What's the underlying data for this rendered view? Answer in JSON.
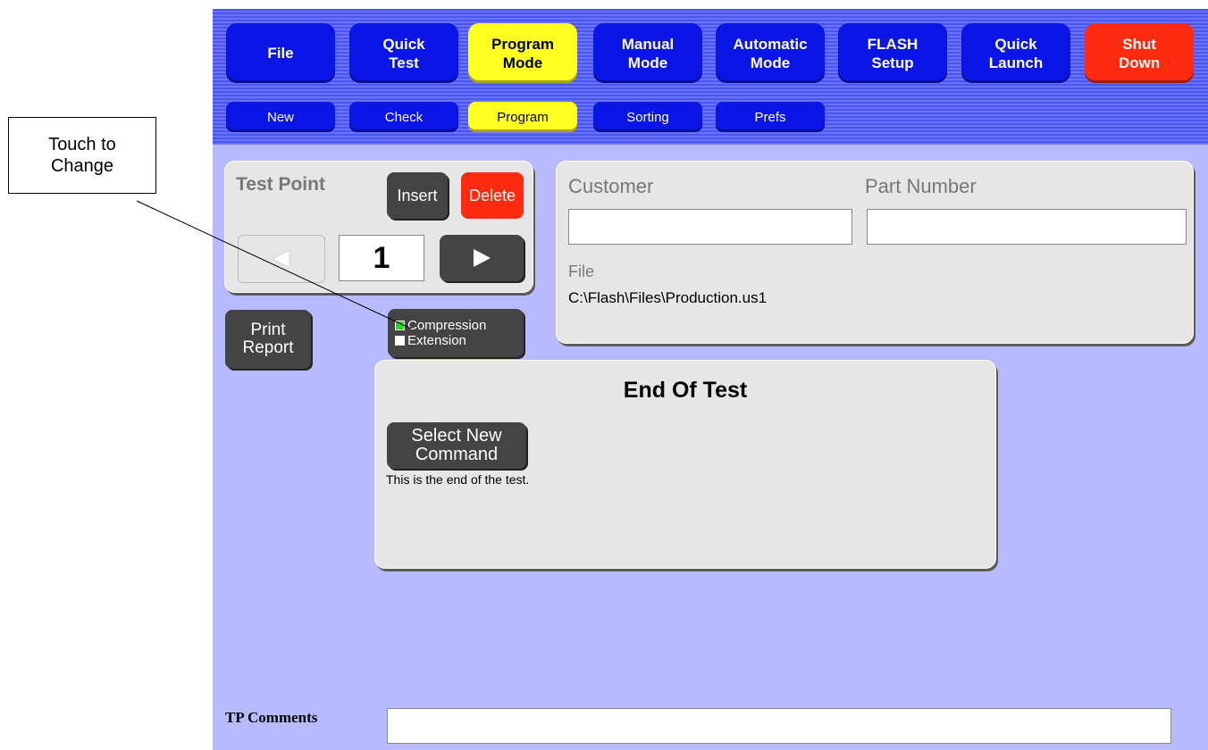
{
  "callout": {
    "text_line1": "Touch to",
    "text_line2": "Change"
  },
  "top_nav": [
    {
      "label": "File",
      "state": "normal"
    },
    {
      "label": "Quick\nTest",
      "state": "normal"
    },
    {
      "label": "Program\nMode",
      "state": "active"
    },
    {
      "label": "Manual\nMode",
      "state": "normal"
    },
    {
      "label": "Automatic\nMode",
      "state": "normal"
    },
    {
      "label": "FLASH\nSetup",
      "state": "normal"
    },
    {
      "label": "Quick\nLaunch",
      "state": "normal"
    },
    {
      "label": "Shut\nDown",
      "state": "danger"
    }
  ],
  "sub_nav": [
    {
      "label": "New",
      "state": "normal"
    },
    {
      "label": "Check",
      "state": "normal"
    },
    {
      "label": "Program",
      "state": "active"
    },
    {
      "label": "Sorting",
      "state": "normal"
    },
    {
      "label": "Prefs",
      "state": "normal"
    }
  ],
  "test_point": {
    "title": "Test Point",
    "insert_label": "Insert",
    "delete_label": "Delete",
    "number": "1",
    "prev_icon": "left-arrow-icon",
    "next_icon": "right-arrow-icon"
  },
  "mode_toggle": {
    "compression_label": "Compression",
    "extension_label": "Extension",
    "selected": "Compression"
  },
  "print_report_label": "Print\nReport",
  "info": {
    "customer_label": "Customer",
    "customer_value": "",
    "part_number_label": "Part Number",
    "part_number_value": "",
    "file_label": "File",
    "file_path": "C:\\Flash\\Files\\Production.us1"
  },
  "command": {
    "title": "End Of Test",
    "select_label": "Select New\nCommand",
    "description": "This is the end of the test."
  },
  "tp_comments": {
    "label": "TP Comments",
    "value": ""
  },
  "colors": {
    "background": "#b7baff",
    "nav_blue": "#0a16e6",
    "active_yellow": "#ffff22",
    "danger_red": "#ff2a10",
    "indicator_green": "#19e019"
  }
}
